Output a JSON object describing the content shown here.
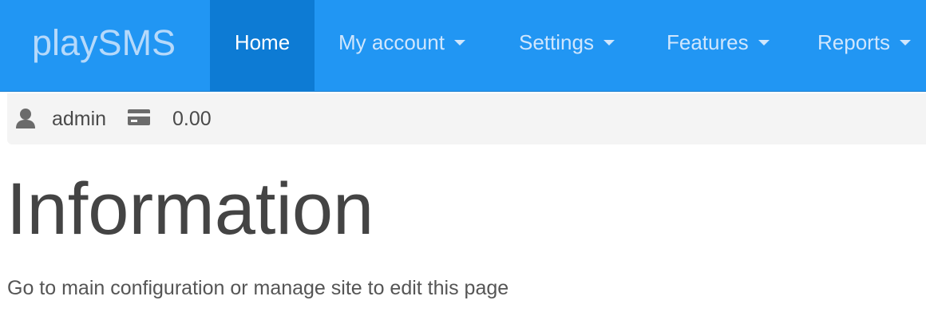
{
  "navbar": {
    "brand": "playSMS",
    "items": [
      {
        "label": "Home",
        "active": true,
        "dropdown": false
      },
      {
        "label": "My account",
        "active": false,
        "dropdown": true
      },
      {
        "label": "Settings",
        "active": false,
        "dropdown": true
      },
      {
        "label": "Features",
        "active": false,
        "dropdown": true
      },
      {
        "label": "Reports",
        "active": false,
        "dropdown": true
      }
    ],
    "colors": {
      "background": "#2196f3",
      "active": "#0d7bd4"
    }
  },
  "status": {
    "user_icon": "user-icon",
    "username": "admin",
    "credit_icon": "credit-card-icon",
    "credit": "0.00"
  },
  "main": {
    "title": "Information",
    "text": "Go to main configuration or manage site to edit this page"
  }
}
